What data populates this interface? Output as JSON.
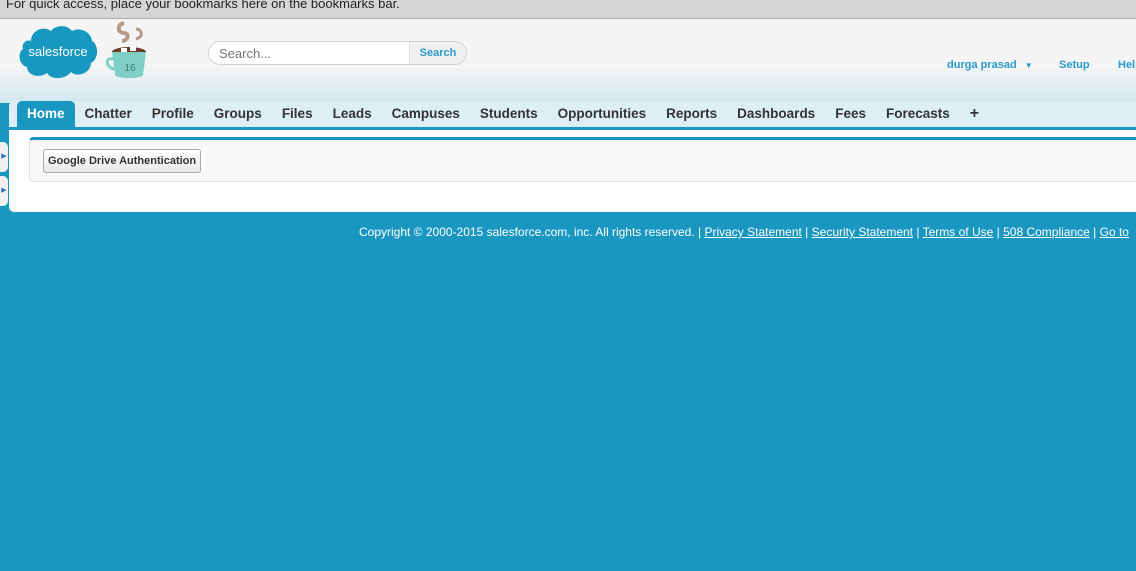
{
  "bookmarks_bar": {
    "message": "For quick access, place your bookmarks here on the bookmarks bar."
  },
  "header": {
    "logo_text": "salesforce",
    "release_badge": "16",
    "search_placeholder": "Search...",
    "search_button": "Search",
    "user_menu": "durga prasad",
    "setup": "Setup",
    "help": "Help"
  },
  "tabs": [
    "Home",
    "Chatter",
    "Profile",
    "Groups",
    "Files",
    "Leads",
    "Campuses",
    "Students",
    "Opportunities",
    "Reports",
    "Dashboards",
    "Fees",
    "Forecasts",
    "+"
  ],
  "content": {
    "google_drive_button": "Google Drive Authentication"
  },
  "footer": {
    "copyright": "Copyright © 2000-2015 salesforce.com, inc. All rights reserved. |",
    "links": [
      "Privacy Statement",
      "Security Statement",
      "Terms of Use",
      "508 Compliance",
      "Go to"
    ]
  },
  "colors": {
    "brand": "#1a97c0",
    "link": "#2a9bc9"
  }
}
